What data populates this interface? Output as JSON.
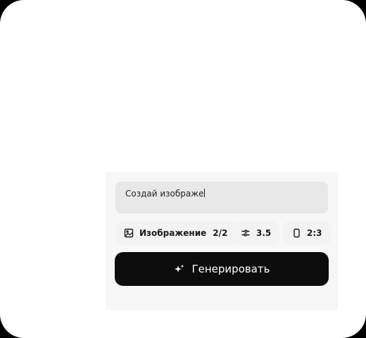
{
  "prompt": {
    "value": "Создай изображе"
  },
  "options": {
    "image": {
      "label": "Изображение",
      "count": "2/2",
      "icon": "image-icon"
    },
    "quality": {
      "label": "3.5",
      "icon": "sliders-icon"
    },
    "ratio": {
      "label": "2:3",
      "icon": "portrait-ratio-icon"
    }
  },
  "generate": {
    "label": "Генерировать",
    "icon": "sparkles-icon"
  },
  "colors": {
    "button": "#0c0c0c",
    "input_bg": "#e8e8e8",
    "panel_bg": "#f7f7f7"
  }
}
